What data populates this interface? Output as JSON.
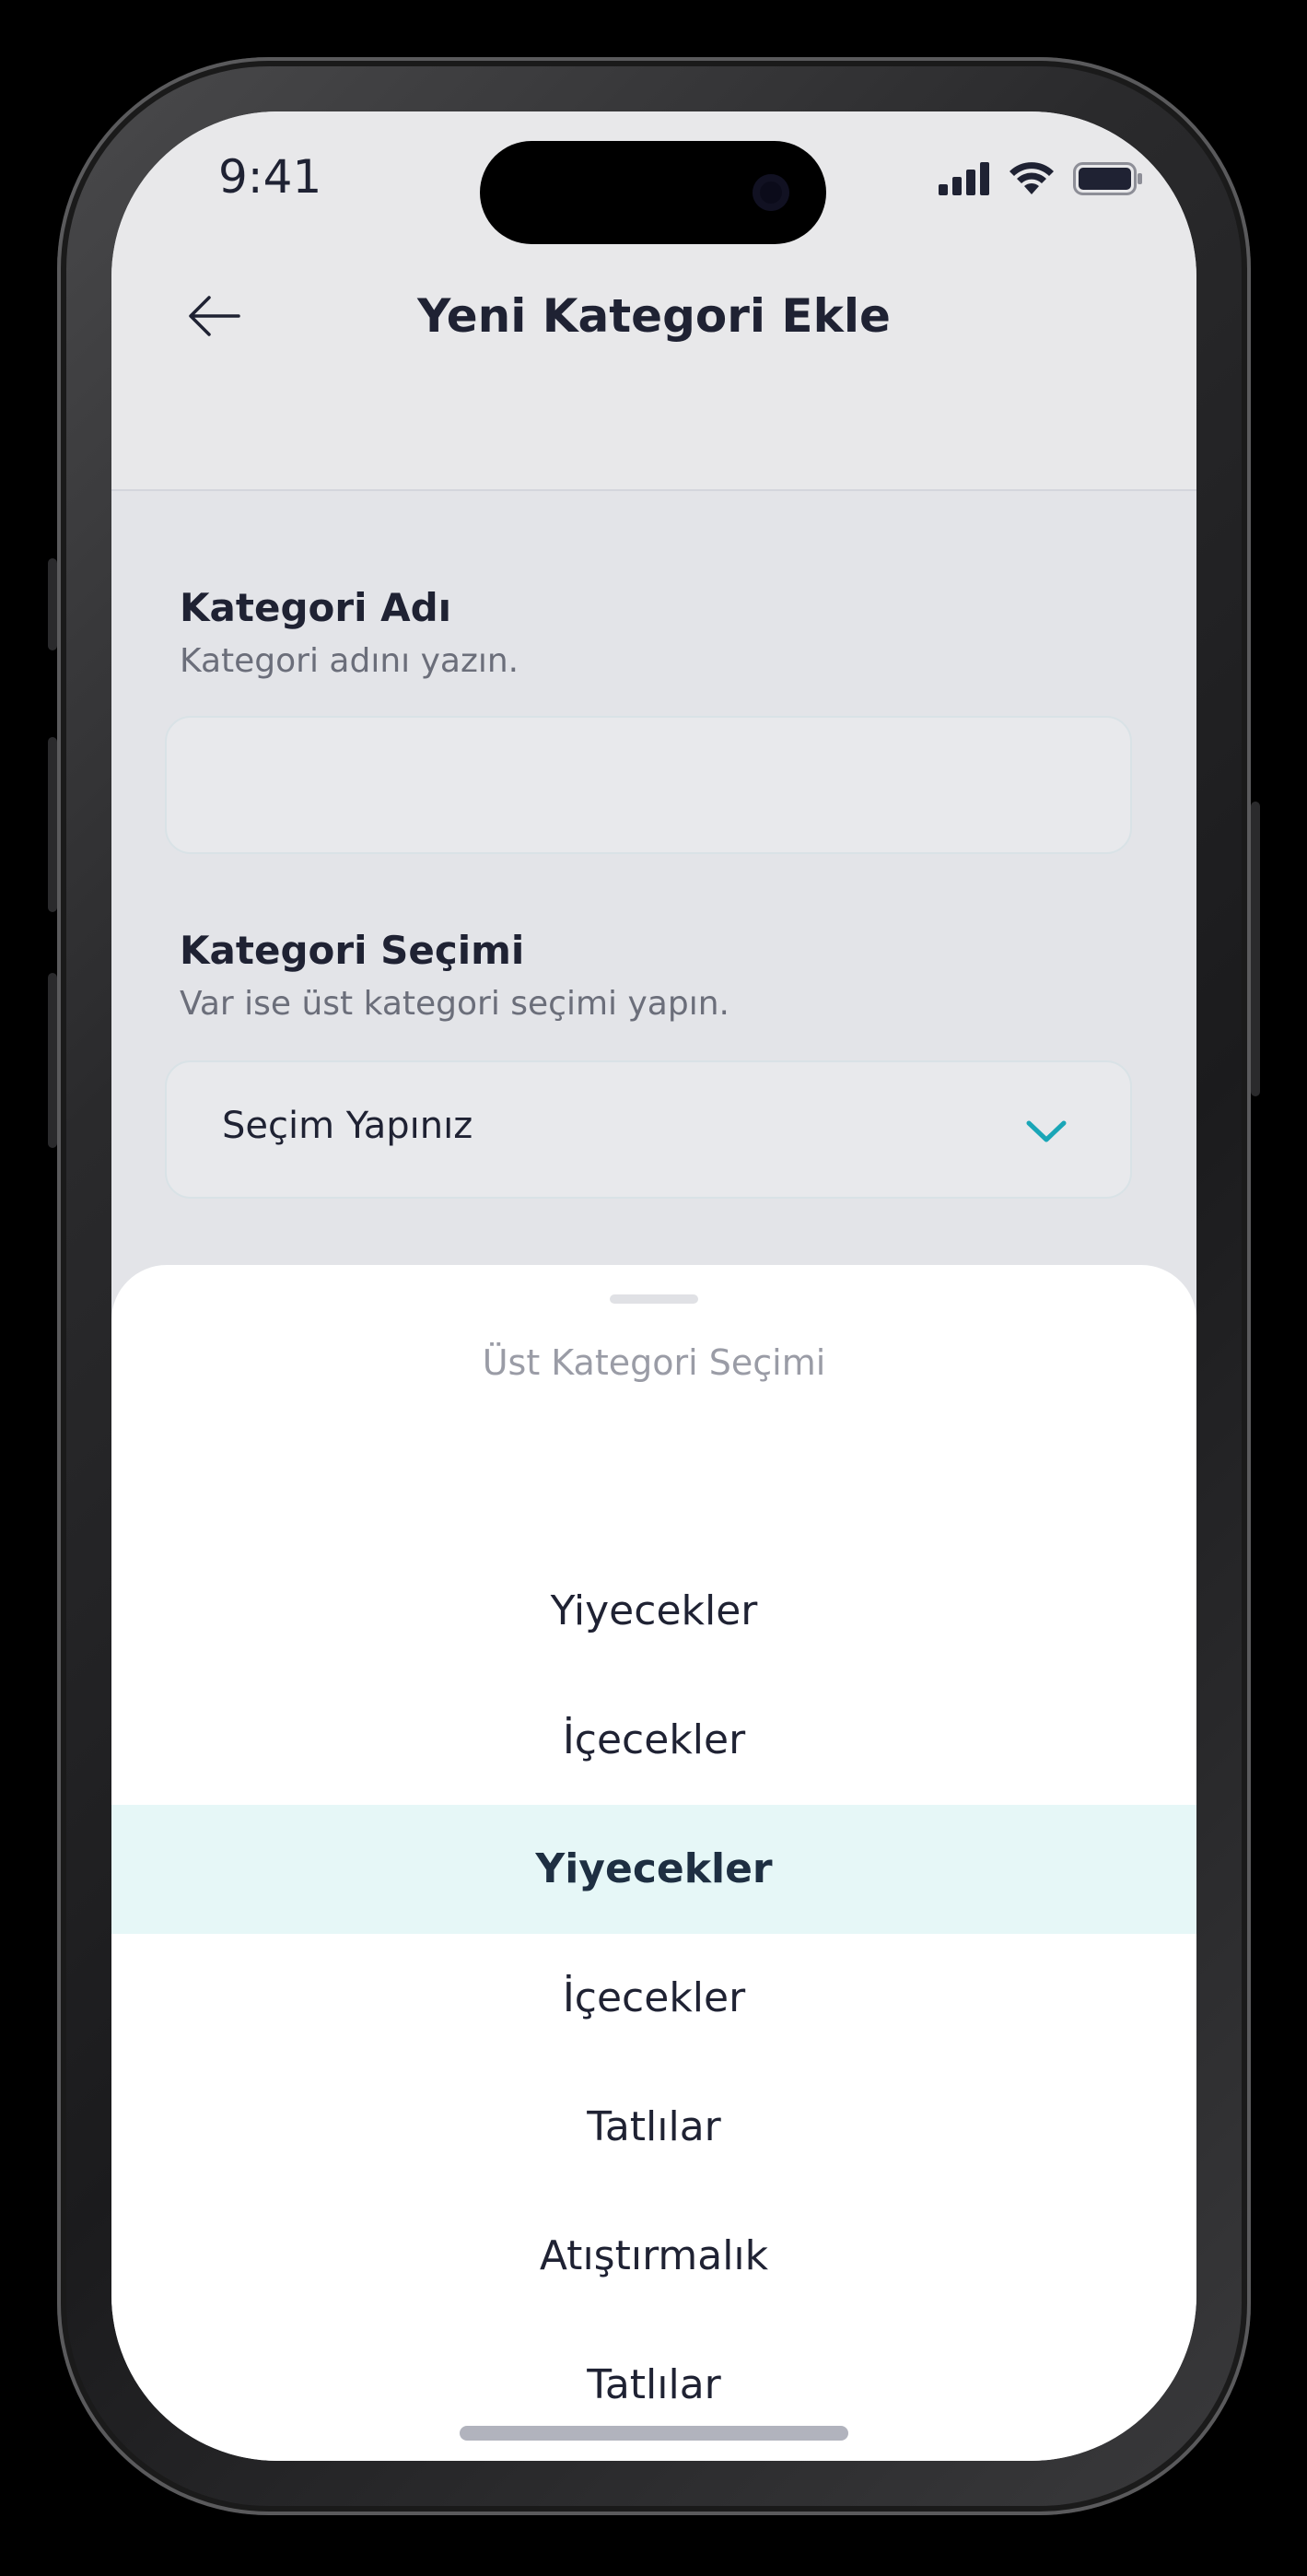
{
  "status_bar": {
    "time": "9:41"
  },
  "header": {
    "title": "Yeni Kategori Ekle"
  },
  "form": {
    "name_field": {
      "label": "Kategori Adı",
      "hint": "Kategori adını yazın.",
      "value": ""
    },
    "category_field": {
      "label": "Kategori Seçimi",
      "hint": "Var ise üst kategori seçimi yapın.",
      "selected_value": "Seçim Yapınız"
    }
  },
  "sheet": {
    "title": "Üst Kategori Seçimi",
    "options": [
      {
        "label": "Yiyecekler",
        "selected": false
      },
      {
        "label": "İçecekler",
        "selected": false
      },
      {
        "label": "Yiyecekler",
        "selected": true
      },
      {
        "label": "İçecekler",
        "selected": false
      },
      {
        "label": "Tatlılar",
        "selected": false
      },
      {
        "label": "Atıştırmalık",
        "selected": false
      },
      {
        "label": "Tatlılar",
        "selected": false
      }
    ]
  },
  "colors": {
    "accent": "#1aa6b7",
    "selected_bg": "#e6f7f7",
    "text_primary": "#1f2233"
  },
  "icons": {
    "back": "arrow-left-icon",
    "dropdown": "chevron-down-icon",
    "signal": "cellular-signal-icon",
    "wifi": "wifi-icon",
    "battery": "battery-icon"
  }
}
